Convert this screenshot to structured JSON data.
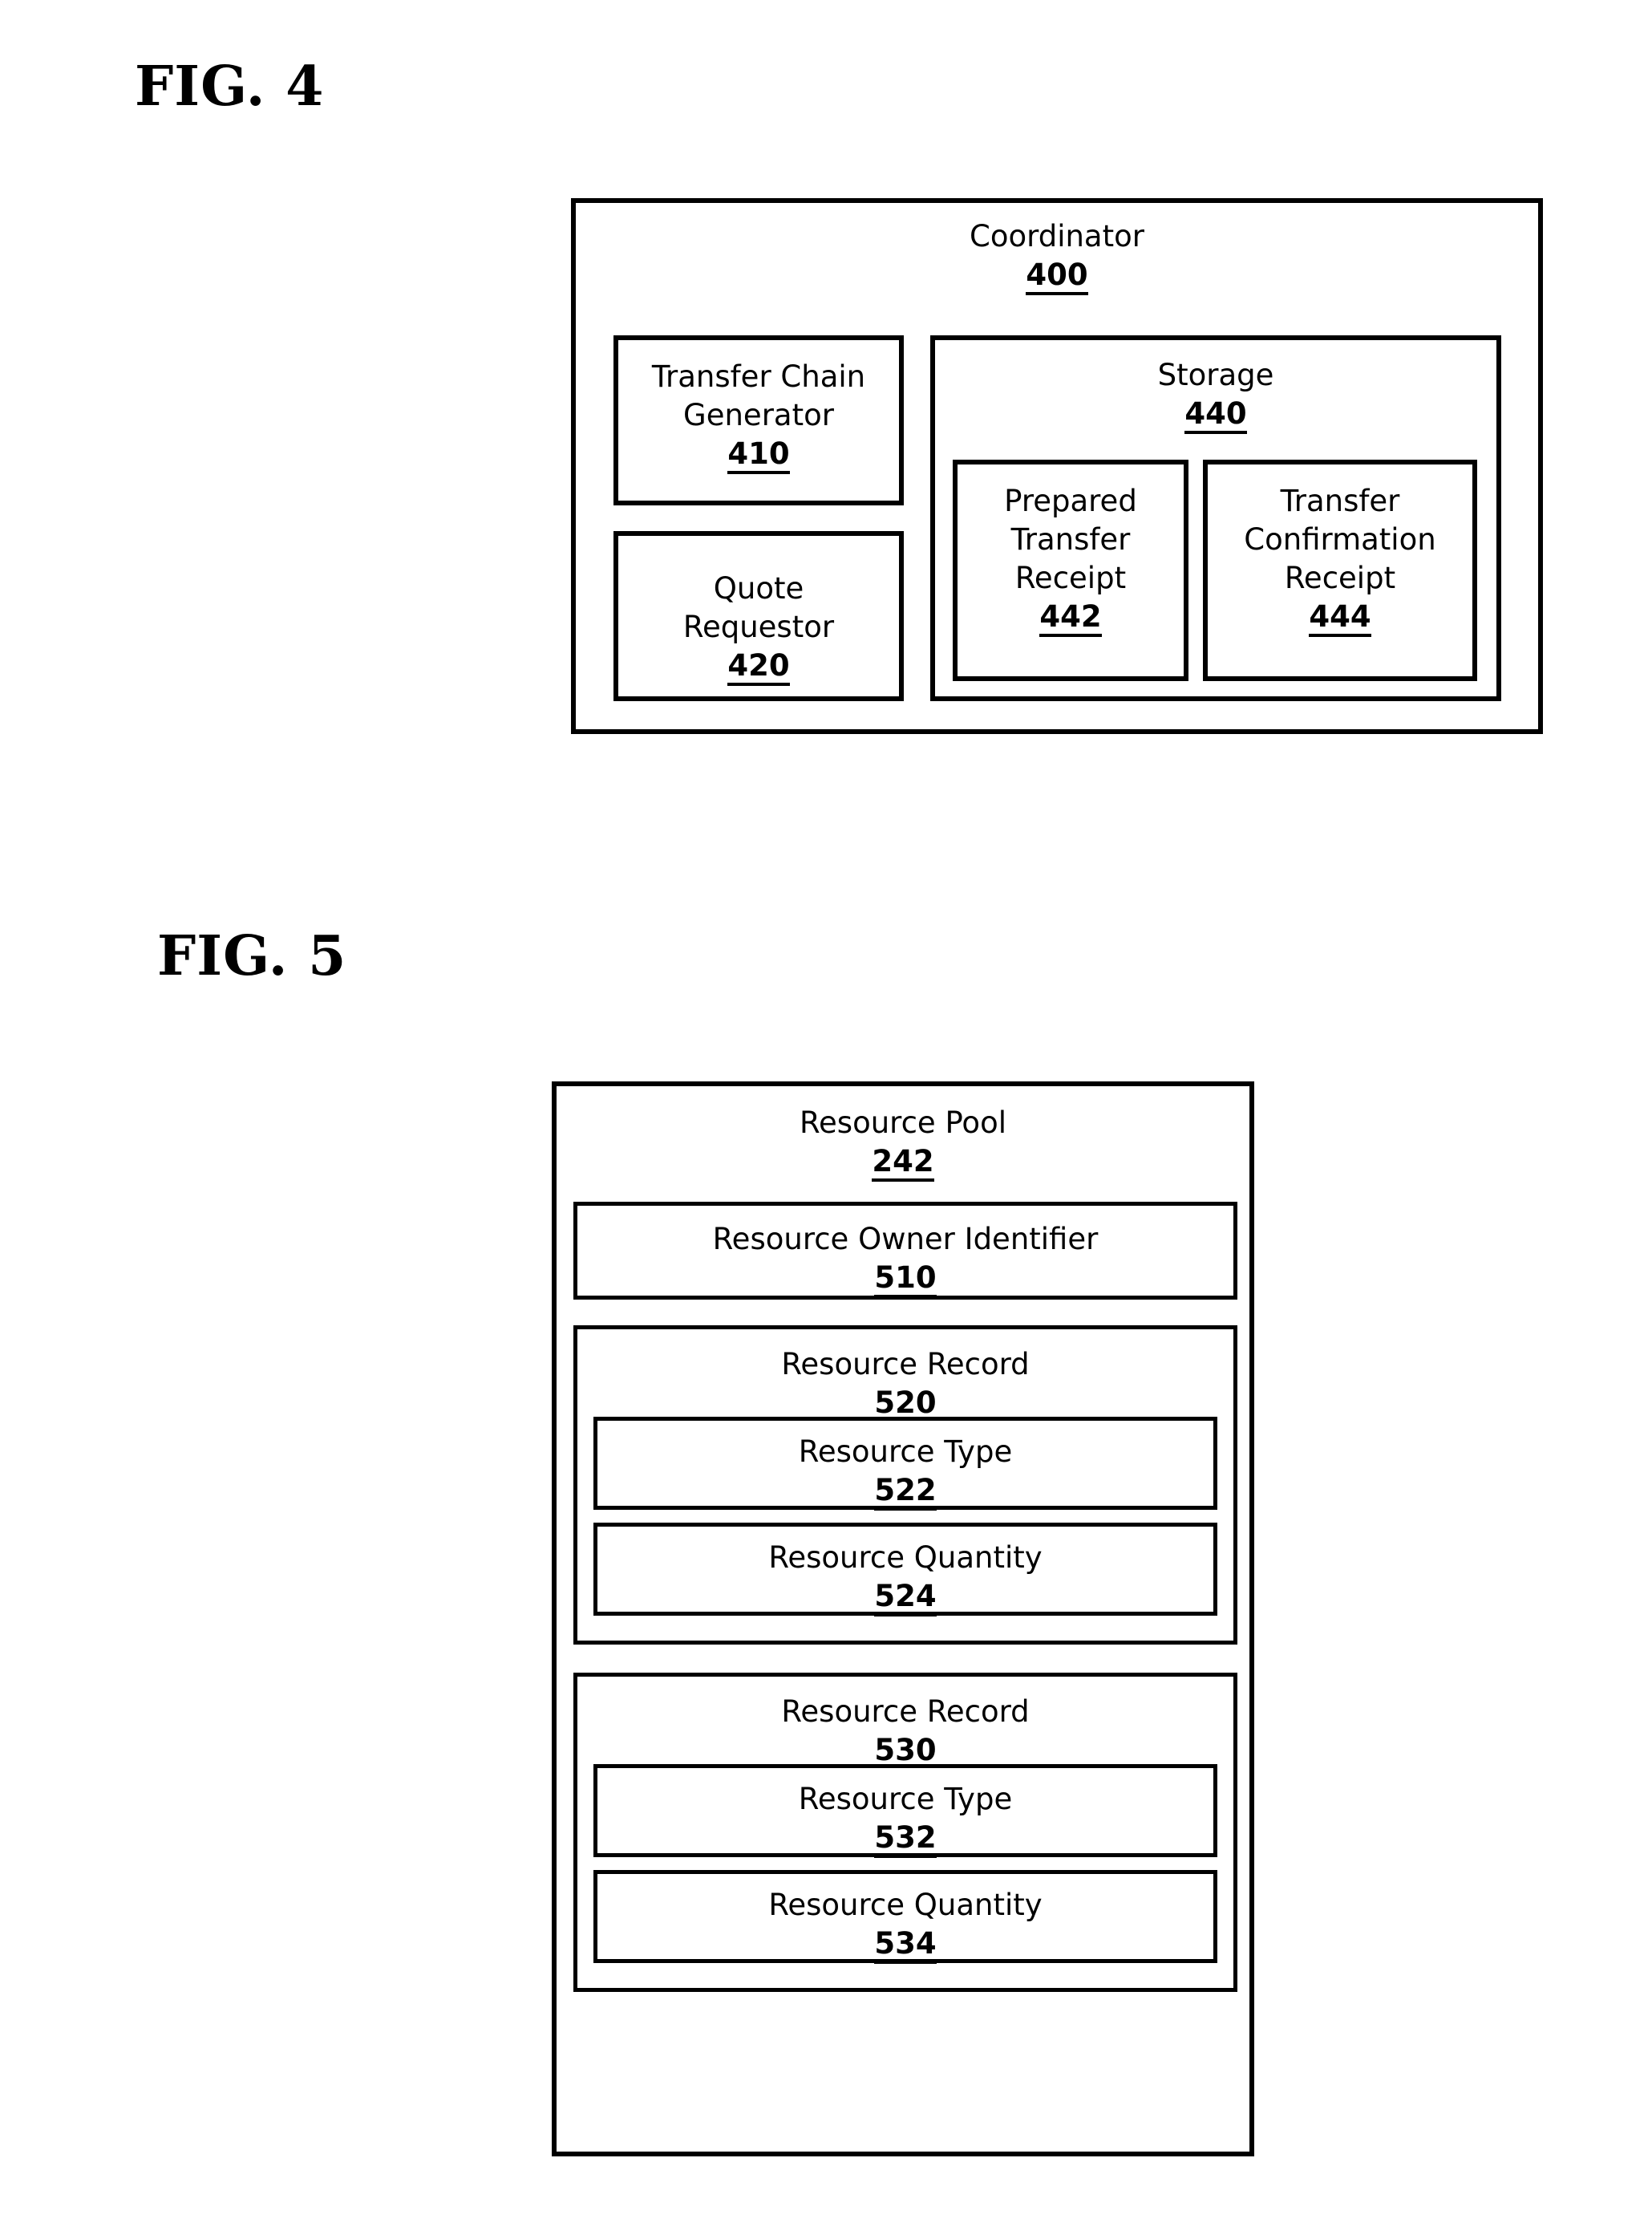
{
  "figures": [
    {
      "label": "FIG. 4",
      "root": {
        "title": "Coordinator",
        "ref": "400",
        "children": [
          {
            "title": "Transfer Chain\nGenerator",
            "ref": "410"
          },
          {
            "title": "Quote\nRequestor",
            "ref": "420"
          },
          {
            "title": "Storage",
            "ref": "440",
            "children": [
              {
                "title": "Prepared\nTransfer\nReceipt",
                "ref": "442"
              },
              {
                "title": "Transfer\nConfirmation\nReceipt",
                "ref": "444"
              }
            ]
          }
        ]
      }
    },
    {
      "label": "FIG. 5",
      "root": {
        "title": "Resource Pool",
        "ref": "242",
        "children": [
          {
            "title": "Resource Owner Identifier",
            "ref": "510"
          },
          {
            "title": "Resource Record",
            "ref": "520",
            "children": [
              {
                "title": "Resource Type",
                "ref": "522"
              },
              {
                "title": "Resource Quantity",
                "ref": "524"
              }
            ]
          },
          {
            "title": "Resource Record",
            "ref": "530",
            "children": [
              {
                "title": "Resource Type",
                "ref": "532"
              },
              {
                "title": "Resource Quantity",
                "ref": "534"
              }
            ]
          }
        ]
      }
    }
  ],
  "fig4": {
    "label": "FIG. 4",
    "coordinator": {
      "title": "Coordinator",
      "ref": "400"
    },
    "transfer_chain_generator": {
      "title": "Transfer Chain\nGenerator",
      "ref": "410"
    },
    "quote_requestor": {
      "title": "Quote\nRequestor",
      "ref": "420"
    },
    "storage": {
      "title": "Storage",
      "ref": "440"
    },
    "prepared_transfer_receipt": {
      "title": "Prepared\nTransfer\nReceipt",
      "ref": "442"
    },
    "transfer_confirmation_receipt": {
      "title": "Transfer\nConfirmation\nReceipt",
      "ref": "444"
    }
  },
  "fig5": {
    "label": "FIG. 5",
    "resource_pool": {
      "title": "Resource Pool",
      "ref": "242"
    },
    "resource_owner_identifier": {
      "title": "Resource Owner Identifier",
      "ref": "510"
    },
    "resource_record_1": {
      "title": "Resource Record",
      "ref": "520"
    },
    "resource_type_1": {
      "title": "Resource Type",
      "ref": "522"
    },
    "resource_quantity_1": {
      "title": "Resource Quantity",
      "ref": "524"
    },
    "resource_record_2": {
      "title": "Resource Record",
      "ref": "530"
    },
    "resource_type_2": {
      "title": "Resource Type",
      "ref": "532"
    },
    "resource_quantity_2": {
      "title": "Resource Quantity",
      "ref": "534"
    }
  },
  "colors": {
    "ink": "#000000",
    "page": "#ffffff"
  }
}
